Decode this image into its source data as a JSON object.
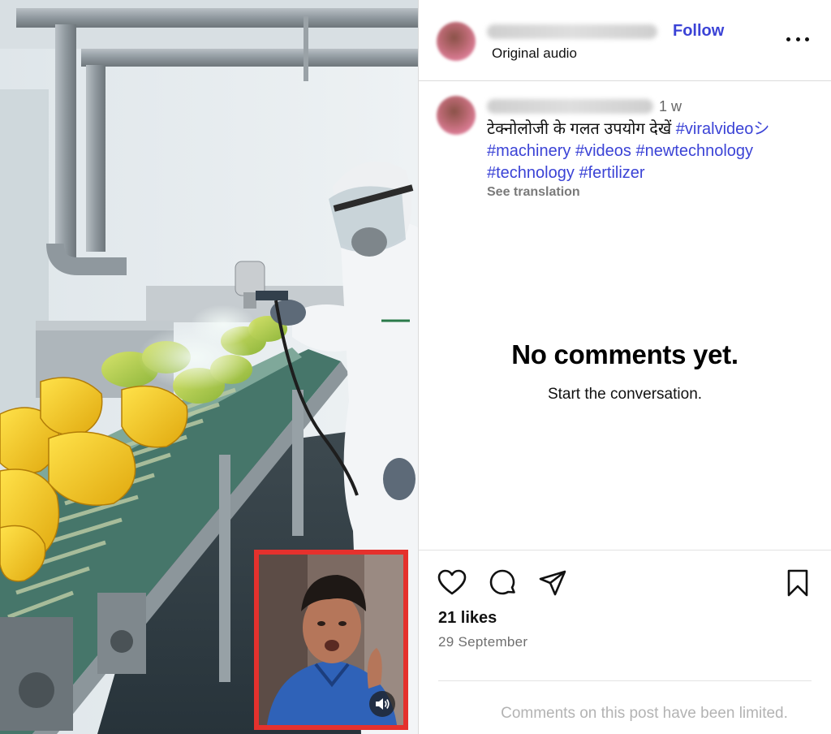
{
  "post": {
    "author_avatar_icon": "blurred-profile-avatar",
    "follow_label": "Follow",
    "audio_label": "Original audio",
    "more_icon": "more-options-icon"
  },
  "caption": {
    "time_ago": "1 w",
    "text": "टेक्नोलोजी के गलत उपयोग देखें",
    "hashtags": [
      "#viralvideoシ",
      "#machinery",
      "#videos",
      "#newtechnology",
      "#technology",
      "#fertilizer"
    ],
    "see_translation": "See translation"
  },
  "comments": {
    "empty_title": "No comments yet.",
    "empty_subtitle": "Start the conversation.",
    "limited_notice": "Comments on this post have been limited."
  },
  "actions": {
    "like_icon": "heart-icon",
    "comment_icon": "comment-icon",
    "share_icon": "send-icon",
    "save_icon": "bookmark-icon"
  },
  "stats": {
    "likes": "21 likes",
    "date": "29 September"
  },
  "media": {
    "overlay_icon": "speaker-icon",
    "overlay_border_color": "#e5312d"
  },
  "colors": {
    "link": "#3b43d6",
    "muted": "#6f6f6f"
  }
}
